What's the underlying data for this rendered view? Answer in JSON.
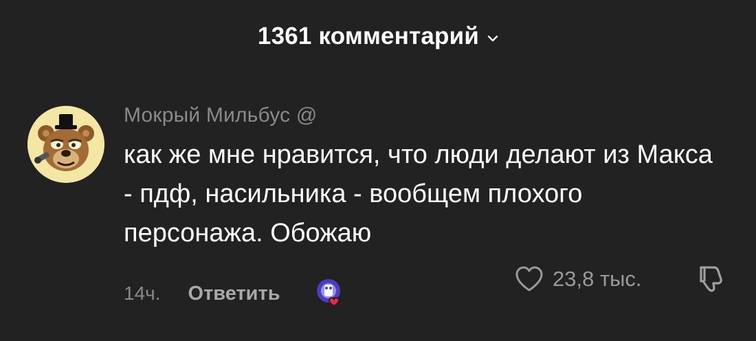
{
  "header": {
    "title": "1361 комментарий",
    "chevron_icon": "chevron-down-icon"
  },
  "comment": {
    "username": "Мокрый Мильбус @",
    "text": "как же мне нравится, что люди делают из Макса - пдф, насильника - вообщем плохого персонажа. Обожаю",
    "time": "14ч.",
    "reply_label": "Ответить",
    "likes": "23,8 тыс.",
    "avatar_icon": "freddy-avatar-icon",
    "creator_like_icon": "creator-liked-icon",
    "like_icon": "heart-outline-icon",
    "dislike_icon": "thumbs-down-icon"
  },
  "colors": {
    "background": "#222222",
    "text_primary": "#ffffff",
    "text_secondary": "#8a8a8a",
    "heart_red": "#f0254e"
  }
}
